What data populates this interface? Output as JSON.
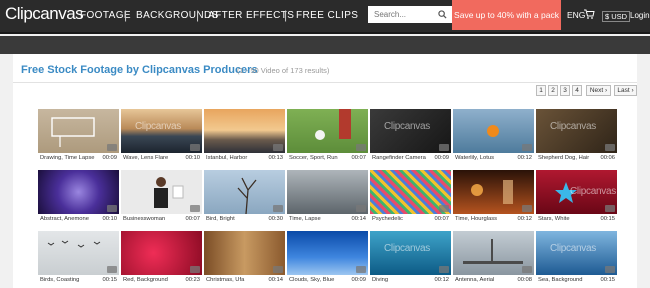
{
  "header": {
    "logo": "Clipcanvas",
    "nav": [
      "FOOTAGE",
      "BACKGROUNDS",
      "AFTER EFFECTS",
      "FREE CLIPS"
    ],
    "search_placeholder": "Search...",
    "search_icon": "search-icon",
    "promo": "Save up to 40% with a pack",
    "lang": "ENG",
    "cart_icon": "cart-icon",
    "currency": "$ USD",
    "login": "Login"
  },
  "page": {
    "title": "Free Stock Footage by Clipcanvas Producers",
    "results": "(1 - 50  Video of 173 results)"
  },
  "pagination": [
    "1",
    "2",
    "3",
    "4",
    "Next ›",
    "Last ›"
  ],
  "clips": [
    {
      "caption": "Drawing, Time Lapse",
      "duration": "00:09"
    },
    {
      "caption": "Wave, Lens Flare",
      "duration": "00:10"
    },
    {
      "caption": "Istanbul, Harbor",
      "duration": "00:13"
    },
    {
      "caption": "Soccer, Sport, Run",
      "duration": "00:07"
    },
    {
      "caption": "Rangefinder Camera",
      "duration": "00:09"
    },
    {
      "caption": "Waterlily, Lotus",
      "duration": "00:12"
    },
    {
      "caption": "Shepherd Dog, Hair",
      "duration": "00:06"
    },
    {
      "caption": "Abstract, Anemone",
      "duration": "00:10"
    },
    {
      "caption": "Businesswoman",
      "duration": "00:07"
    },
    {
      "caption": "Bird, Bright",
      "duration": "00:30"
    },
    {
      "caption": "Time, Lapse",
      "duration": "00:14"
    },
    {
      "caption": "Psychedelic",
      "duration": "00:07"
    },
    {
      "caption": "Time, Hourglass",
      "duration": "00:12"
    },
    {
      "caption": "Stars, White",
      "duration": "00:15"
    },
    {
      "caption": "Birds, Coasting",
      "duration": "00:15"
    },
    {
      "caption": "Red, Background",
      "duration": "00:23"
    },
    {
      "caption": "Christmas, Ufa",
      "duration": "00:14"
    },
    {
      "caption": "Clouds, Sky, Blue",
      "duration": "00:09"
    },
    {
      "caption": "Diving",
      "duration": "00:12"
    },
    {
      "caption": "Antenna, Aerial",
      "duration": "00:08"
    },
    {
      "caption": "Sea, Background",
      "duration": "00:15"
    }
  ]
}
